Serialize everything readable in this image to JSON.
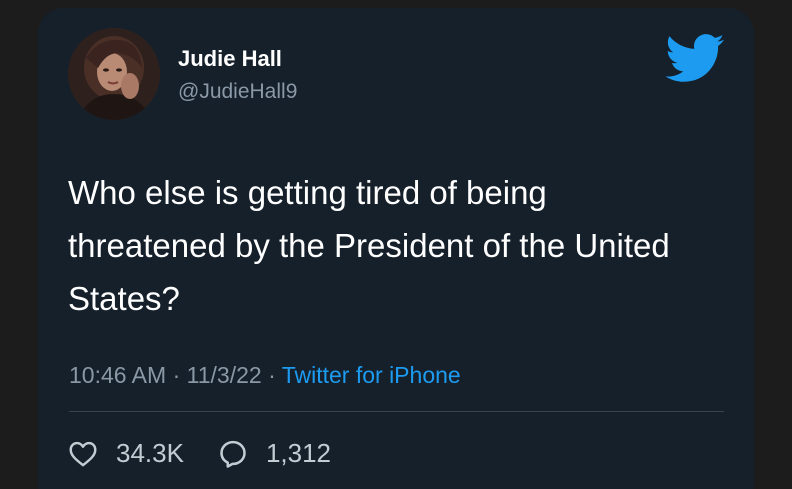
{
  "tweet": {
    "display_name": "Judie Hall",
    "handle": "@JudieHall9",
    "text": "Who else is getting tired of being threatened by the President of the United States?",
    "time": "10:46 AM",
    "separator": "·",
    "date": "11/3/22",
    "source": "Twitter for iPhone"
  },
  "stats": {
    "likes": "34.3K",
    "replies": "1,312"
  },
  "icons": {
    "brand": "twitter-bird-icon",
    "like": "heart-icon",
    "reply": "speech-bubble-icon"
  },
  "colors": {
    "background": "#15202b",
    "accent": "#1d9bf0",
    "secondary_text": "#8b98a5"
  }
}
